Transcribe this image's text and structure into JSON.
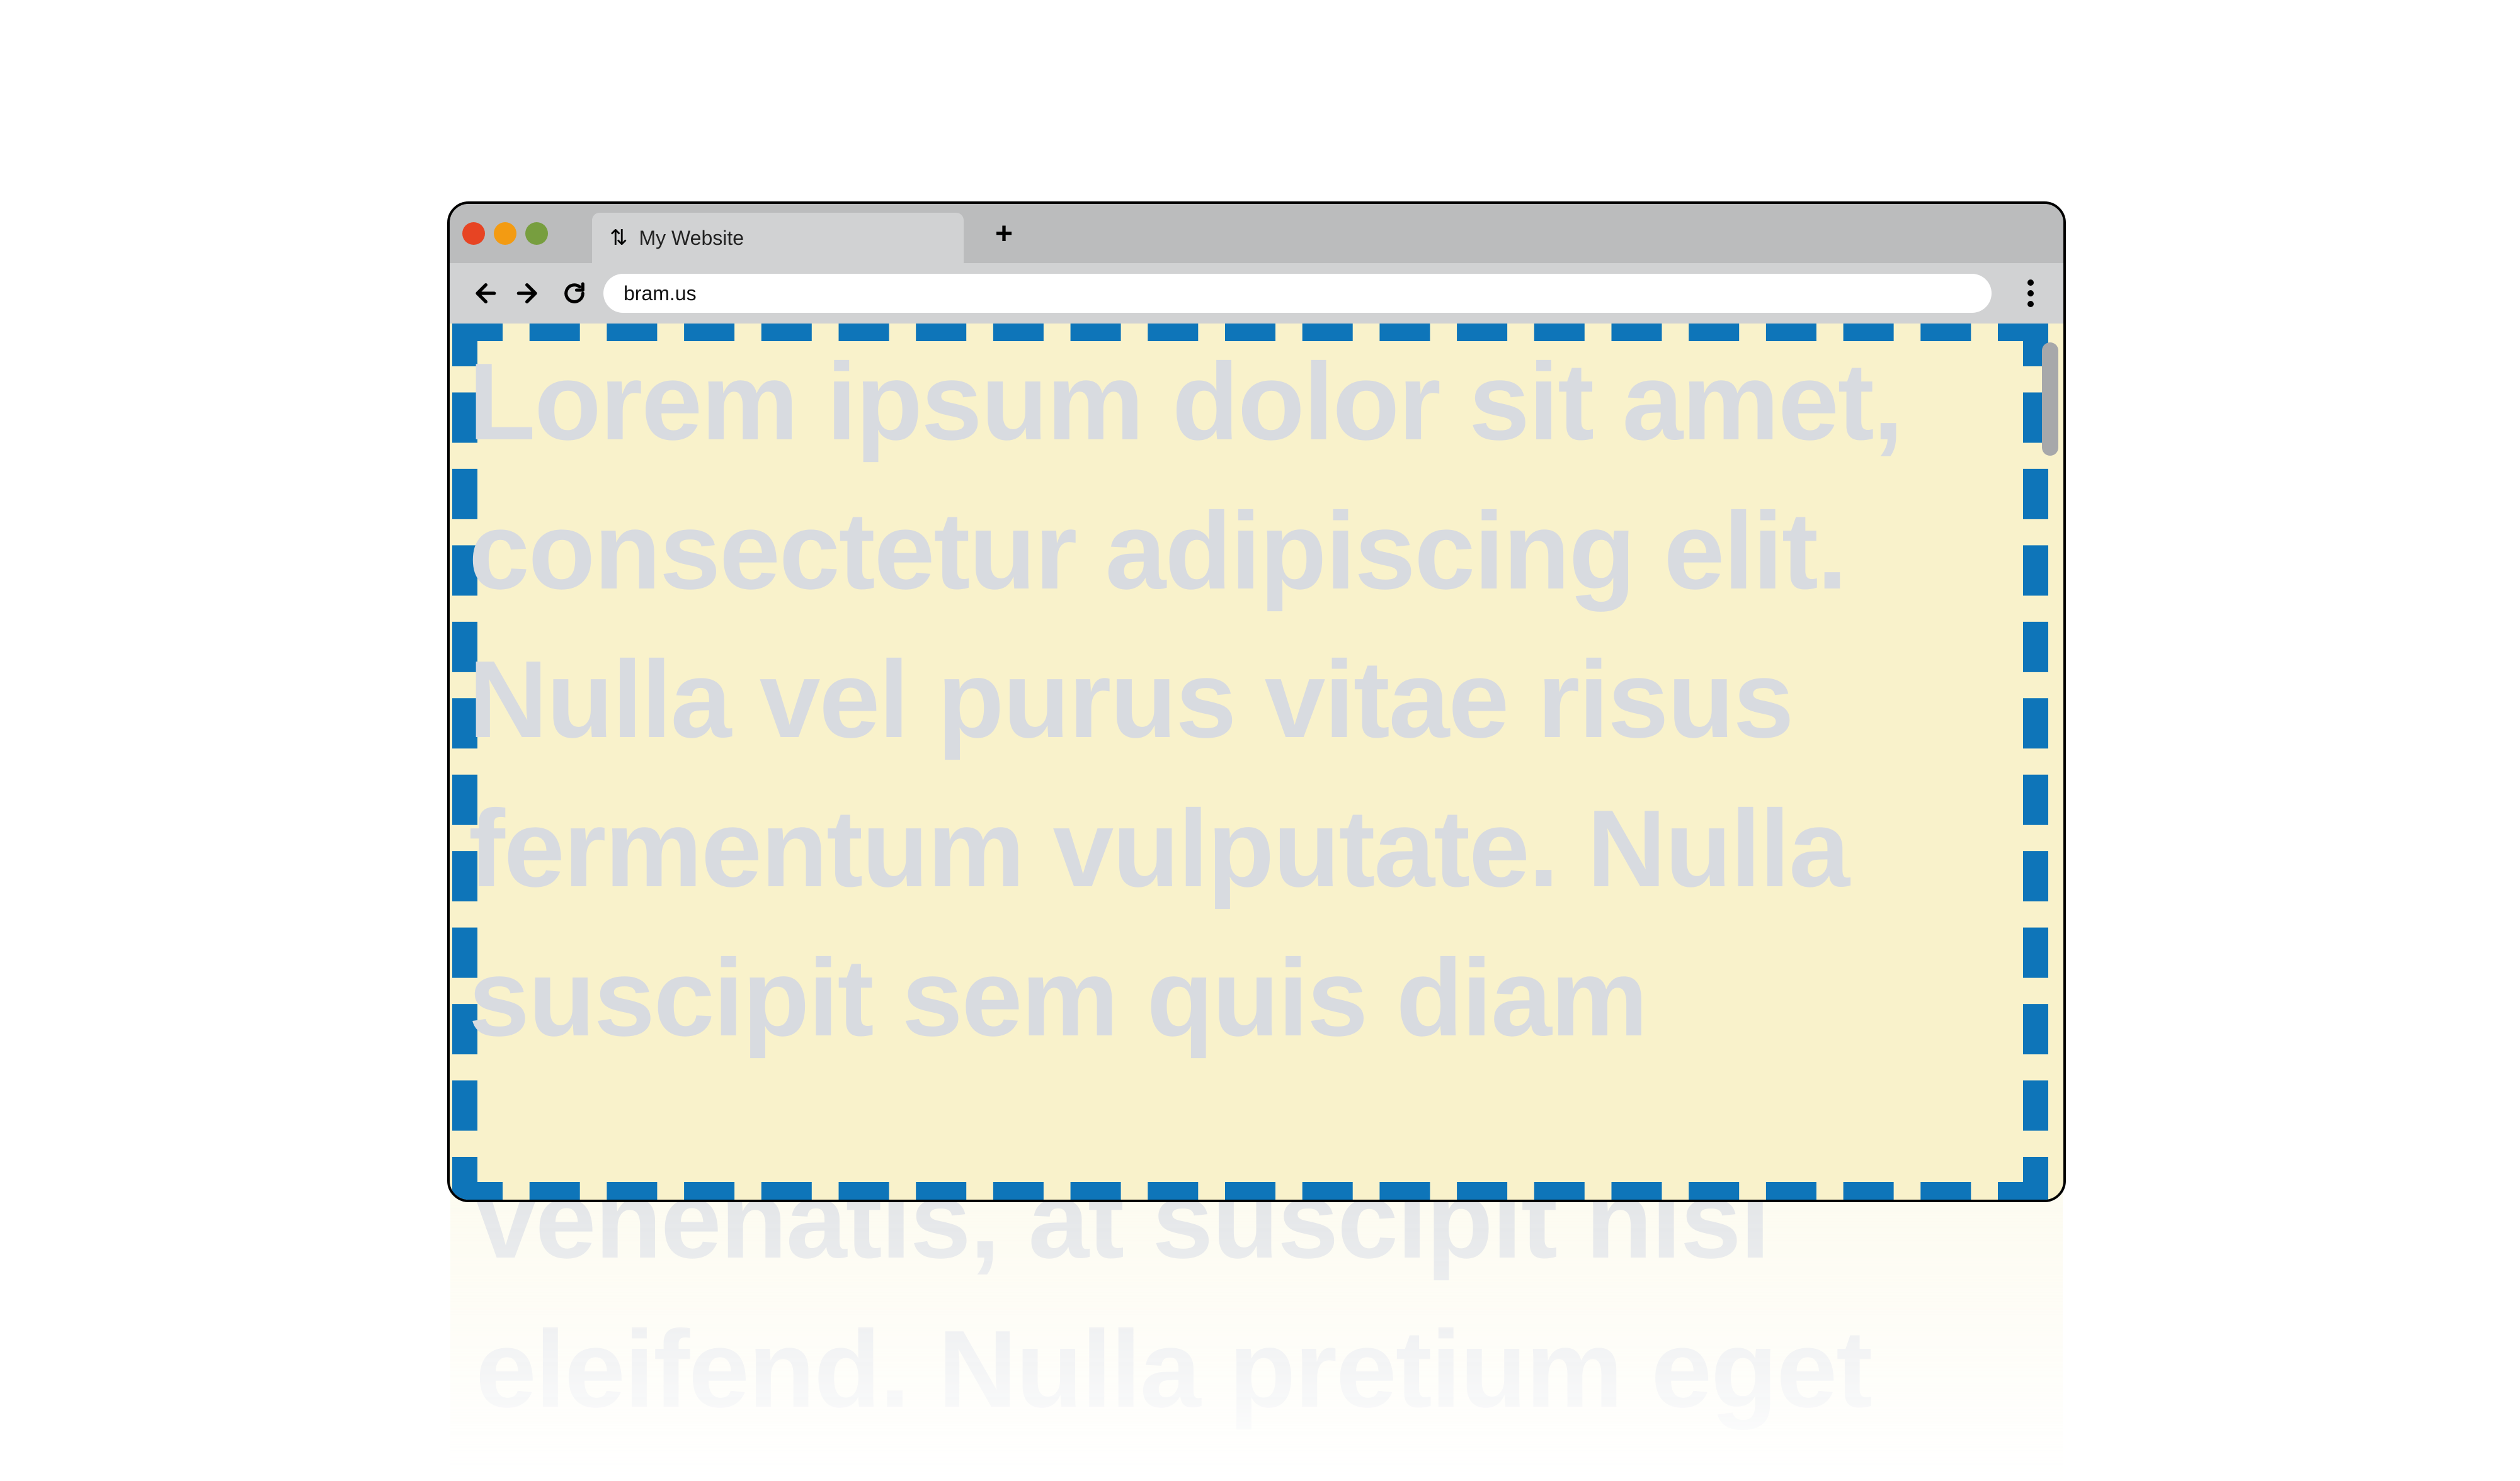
{
  "browser": {
    "tab": {
      "favicon_text": "⇅",
      "title": "My Website"
    },
    "new_tab_label": "+",
    "nav": {
      "back_label": "←",
      "forward_label": "→",
      "reload_label": "↻"
    },
    "address_bar": {
      "url": "bram.us"
    }
  },
  "page": {
    "visible_text": "Lorem ipsum dolor sit amet, consectetur adipiscing elit. Nulla vel purus vitae risus fermentum vulputate. Nulla suscipit sem quis diam",
    "overflow_text": "venenatis, at suscipit nisl eleifend. Nulla pretium eget",
    "border_color": "#0e75b9",
    "background_color": "#f9f2cb",
    "text_color": "#d8dbe0"
  }
}
